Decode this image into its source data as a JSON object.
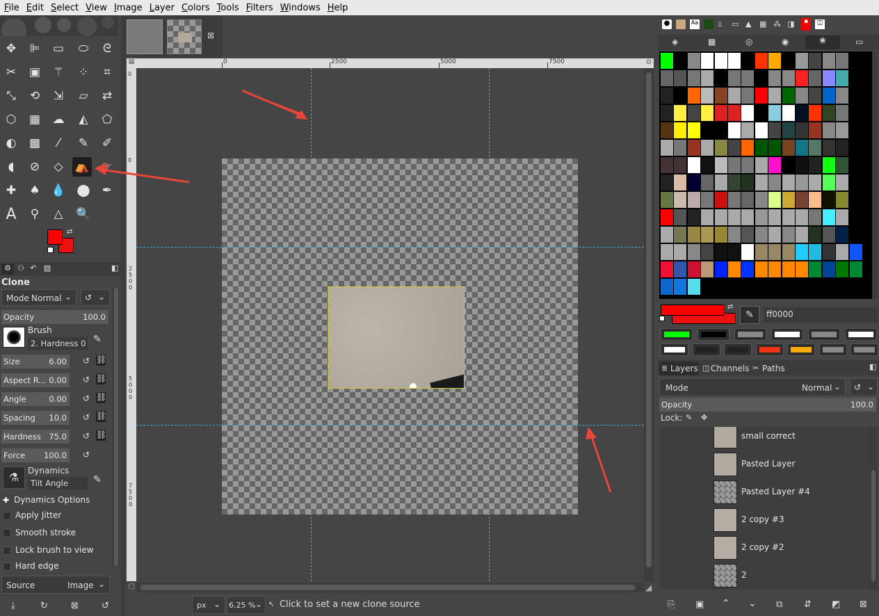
{
  "menu": [
    "File",
    "Edit",
    "Select",
    "View",
    "Image",
    "Layer",
    "Colors",
    "Tools",
    "Filters",
    "Windows",
    "Help"
  ],
  "tool_options": {
    "title": "Clone",
    "mode_label": "Mode",
    "mode_value": "Normal",
    "opacity_label": "Opacity",
    "opacity_value": "100.0",
    "brush_label": "Brush",
    "brush_value": "2. Hardness 0",
    "size_label": "Size",
    "size_value": "6.00",
    "aspect_label": "Aspect R...",
    "aspect_value": "0.00",
    "angle_label": "Angle",
    "angle_value": "0.00",
    "spacing_label": "Spacing",
    "spacing_value": "10.0",
    "hardness_label": "Hardness",
    "hardness_value": "75.0",
    "force_label": "Force",
    "force_value": "100.0",
    "dynamics_label": "Dynamics",
    "dynamics_value": "Tilt Angle",
    "dynamics_options": "Dynamics Options",
    "apply_jitter": "Apply Jitter",
    "smooth_stroke": "Smooth stroke",
    "lock_brush": "Lock brush to view",
    "hard_edge": "Hard edge",
    "source_label": "Source",
    "source_value": "Image"
  },
  "ruler": {
    "h_ticks": [
      "0",
      "2500",
      "5000",
      "7500"
    ],
    "v_ticks": [
      "0",
      "0",
      "2 5 0 0",
      "5 0 0 0",
      "7 5 0 0"
    ]
  },
  "statusbar": {
    "unit": "px",
    "zoom": "6.25 %",
    "message": "Click to set a new clone source"
  },
  "colors": {
    "fg": "#ff0000",
    "bg": "#ee1111",
    "hex_value": "ff0000",
    "accent": "#3aa7d6"
  },
  "palette": [
    [
      "#00ff00",
      "#000000",
      "#888888",
      "#ffffff",
      "#ffffff",
      "#ffffff",
      "#000000",
      "#ff3300",
      "#ffaa00",
      "#000000",
      "#999999",
      "#444444",
      "#888888",
      "#777777"
    ],
    [
      "#666666",
      "#555555",
      "#777777",
      "#aaaaaa",
      "#000000",
      "#777777",
      "#777777",
      "#000000",
      "#888888",
      "#888888",
      "#ff2222",
      "#666666",
      "#8888ff",
      "#44aaaa"
    ],
    [
      "#222222",
      "#000000",
      "#ff6600",
      "#bbbbbb",
      "#884422",
      "#aaaaaa",
      "#777777",
      "#ff0000",
      "#aaaaaa",
      "#006600",
      "#888888",
      "#444444",
      "#0066cc",
      "#888888"
    ],
    [
      "#222222",
      "#ffee44",
      "#444444",
      "#ffee44",
      "#dd2222",
      "#dd2222",
      "#ffffff",
      "#000000",
      "#88ccdd",
      "#ffffff",
      "#001122",
      "#ff3300",
      "#334422",
      "#777777"
    ],
    [
      "#553311",
      "#ffee00",
      "#ffff00",
      "#000000",
      "#000000",
      "#ffffff",
      "#aaaaaa",
      "#ffffff",
      "#444444",
      "#224444",
      "#333333",
      "#993322",
      "#888888",
      "#999999"
    ],
    [
      "#aaaaaa",
      "#777777",
      "#993322",
      "#aaaaaa",
      "#888844",
      "#444444",
      "#ff6600",
      "#005500",
      "#005500",
      "#774422",
      "#117788",
      "#557766",
      "#333333",
      "#222222"
    ],
    [
      "#443333",
      "#443333",
      "#ffffff",
      "#111111",
      "#bbbbbb",
      "#777777",
      "#777777",
      "#aaaaaa",
      "#ff11cc",
      "#000000",
      "#111111",
      "#222222",
      "#11ff11",
      "#335533"
    ],
    [
      "#222222",
      "#ddbbaa",
      "#000033",
      "#666666",
      "#aaaaaa",
      "#334433",
      "#223322",
      "#aaaaaa",
      "#888888",
      "#aaaaaa",
      "#999999",
      "#aaaaaa",
      "#55ff55",
      "#aaaaaa"
    ],
    [
      "#667744",
      "#ccbbaa",
      "#bbaaaa",
      "#777777",
      "#cc1111",
      "#777777",
      "#666666",
      "#888888",
      "#ddff88",
      "#ccaa33",
      "#774433",
      "#ffbb88",
      "#111100",
      "#888833"
    ],
    [
      "#ff0000",
      "#555555",
      "#222222",
      "#aaaaaa",
      "#aaaaaa",
      "#aaaaaa",
      "#aaaaaa",
      "#999999",
      "#aaaaaa",
      "#aaaaaa",
      "#aaaaaa",
      "#777777",
      "#44eeff",
      "#aaaaaa"
    ],
    [
      "#aaaaaa",
      "#777755",
      "#998844",
      "#aa9955",
      "#998833",
      "#888888",
      "#555555",
      "#888888",
      "#aaaaaa",
      "#888888",
      "#aaaaaa",
      "#223322",
      "#555555",
      "#002244"
    ],
    [
      "#aaaaaa",
      "#aaaaaa",
      "#888888",
      "#444444",
      "#111111",
      "#111111",
      "#ffffff",
      "#998866",
      "#998866",
      "#998866",
      "#22ccff",
      "#22bbdd",
      "#333333",
      "#aaaaaa",
      "#1155ff"
    ],
    [
      "#ee1133",
      "#3355aa",
      "#cc1133",
      "#bb9977",
      "#0022ff",
      "#ff8800",
      "#0033ff",
      "#ff8800",
      "#ff8800",
      "#ff8800",
      "#ff8800",
      "#008833",
      "#004499",
      "#007700",
      "#008833"
    ],
    [
      "#1166cc",
      "#1177dd",
      "#55ddee"
    ]
  ],
  "preset_buttons": [
    [
      "#00ff00",
      "#000000",
      "#888888",
      "#ffffff",
      "#888888",
      "#ffffff"
    ],
    [
      "#ffffff",
      "#222222",
      "#222222",
      "#ee3311",
      "#ffaa00",
      "#888888",
      "#888888"
    ]
  ],
  "layers_panel": {
    "tabs": [
      "Layers",
      "Channels",
      "Paths"
    ],
    "mode_label": "Mode",
    "mode_value": "Normal",
    "opacity_label": "Opacity",
    "opacity_value": "100.0",
    "lock_label": "Lock:",
    "items": [
      {
        "name": "small correct",
        "thumb": "#b0aaa0"
      },
      {
        "name": "Pasted Layer",
        "thumb": "#b0aaa0"
      },
      {
        "name": "Pasted Layer #4",
        "thumb": "checker"
      },
      {
        "name": "2 copy #3",
        "thumb": "#b5ada3"
      },
      {
        "name": "2 copy #2",
        "thumb": "#b5ada3"
      },
      {
        "name": "2",
        "thumb": "checker"
      }
    ]
  }
}
